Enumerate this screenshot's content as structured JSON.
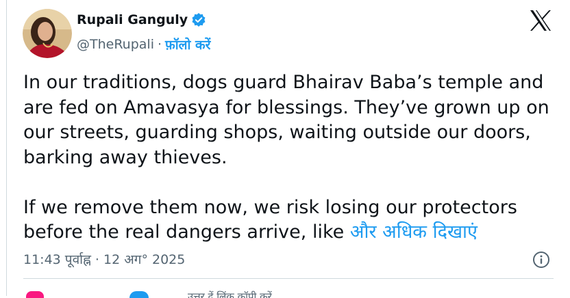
{
  "tweet": {
    "author_name": "Rupali Ganguly",
    "handle": "@TheRupali",
    "separator": "·",
    "follow_label": "फ़ॉलो करें",
    "paragraph_1": "In our traditions, dogs guard Bhairav Baba’s temple and are fed on Amavasya for blessings. They’ve grown up on our streets, guarding shops, waiting outside our doors, barking away thieves.",
    "paragraph_2": "If we remove them now, we risk losing our protectors before the real dangers arrive, like",
    "show_more_label": "और अधिक दिखाएं",
    "timestamp": "11:43 पूर्वाह्न · 12 अग° 2025",
    "actions_partial_text": "उत्तर दें   लिंक कॉपी करें"
  },
  "icons": {
    "verified": "verified-badge-icon",
    "x_logo": "x-logo-icon",
    "info": "info-icon",
    "like": "heart-icon",
    "reply": "reply-icon"
  },
  "colors": {
    "accent": "#1d9bf0",
    "text": "#0f1419",
    "secondary_text": "#536471",
    "like": "#f91880",
    "border": "#cfd9de"
  }
}
